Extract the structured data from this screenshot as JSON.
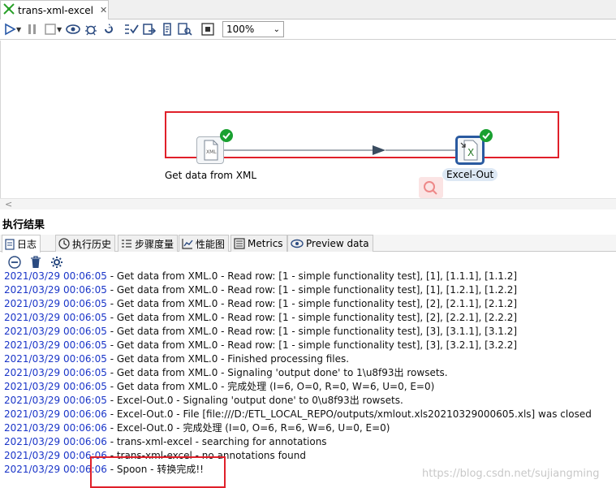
{
  "tab": {
    "title": "trans-xml-excel",
    "close_glyph": "✕"
  },
  "toolbar": {
    "icons": [
      "run-icon",
      "pause-icon",
      "stop-icon",
      "preview-icon",
      "debug-icon",
      "check-icon",
      "impact-icon",
      "sql-icon",
      "explore-db-icon",
      "align-icon"
    ],
    "zoom_value": "100%"
  },
  "canvas": {
    "steps": [
      {
        "label": "Get data from XML",
        "icon_text": "XML"
      },
      {
        "label": "Excel-Out",
        "icon_text": "X"
      }
    ]
  },
  "results": {
    "title": "执行结果",
    "tabs": [
      {
        "label": "日志",
        "icon": "log-icon"
      },
      {
        "label": "执行历史",
        "icon": "history-icon"
      },
      {
        "label": "步骤度量",
        "icon": "step-metrics-icon"
      },
      {
        "label": "性能图",
        "icon": "performance-graph-icon"
      },
      {
        "label": "Metrics",
        "icon": "metrics-icon"
      },
      {
        "label": "Preview data",
        "icon": "preview-data-icon"
      }
    ],
    "log_lines": [
      {
        "ts": "2021/03/29 00:06:05",
        "msg": " - Get data from XML.0 - Read row: [1 - simple functionality test], [1], [1.1.1], [1.1.2]"
      },
      {
        "ts": "2021/03/29 00:06:05",
        "msg": " - Get data from XML.0 - Read row: [1 - simple functionality test], [1], [1.2.1], [1.2.2]"
      },
      {
        "ts": "2021/03/29 00:06:05",
        "msg": " - Get data from XML.0 - Read row: [1 - simple functionality test], [2], [2.1.1], [2.1.2]"
      },
      {
        "ts": "2021/03/29 00:06:05",
        "msg": " - Get data from XML.0 - Read row: [1 - simple functionality test], [2], [2.2.1], [2.2.2]"
      },
      {
        "ts": "2021/03/29 00:06:05",
        "msg": " - Get data from XML.0 - Read row: [1 - simple functionality test], [3], [3.1.1], [3.1.2]"
      },
      {
        "ts": "2021/03/29 00:06:05",
        "msg": " - Get data from XML.0 - Read row: [1 - simple functionality test], [3], [3.2.1], [3.2.2]"
      },
      {
        "ts": "2021/03/29 00:06:05",
        "msg": " - Get data from XML.0 - Finished processing files."
      },
      {
        "ts": "2021/03/29 00:06:05",
        "msg": " - Get data from XML.0 - Signaling 'output done' to 1\\u8f93出 rowsets."
      },
      {
        "ts": "2021/03/29 00:06:05",
        "msg": " - Get data from XML.0 - 完成处理 (I=6, O=0, R=0, W=6, U=0, E=0)"
      },
      {
        "ts": "2021/03/29 00:06:05",
        "msg": " - Excel-Out.0 - Signaling 'output done' to 0\\u8f93出 rowsets."
      },
      {
        "ts": "2021/03/29 00:06:06",
        "msg": " - Excel-Out.0 - File [file:///D:/ETL_LOCAL_REPO/outputs/xmlout.xls20210329000605.xls] was closed"
      },
      {
        "ts": "2021/03/29 00:06:06",
        "msg": " - Excel-Out.0 - 完成处理 (I=0, O=6, R=6, W=6, U=0, E=0)"
      },
      {
        "ts": "2021/03/29 00:06:06",
        "msg": " - trans-xml-excel - searching for annotations"
      },
      {
        "ts": "2021/03/29 00:06:06",
        "msg": " - trans-xml-excel - no annotations found"
      },
      {
        "ts": "2021/03/29 00:06:06",
        "msg": " - Spoon - 转换完成!!"
      }
    ]
  },
  "watermark": "https://blog.csdn.net/sujiangming",
  "colors": {
    "highlight_box": "#e0202a",
    "timestamp": "#1a35c8",
    "ok_badge": "#19a030"
  }
}
